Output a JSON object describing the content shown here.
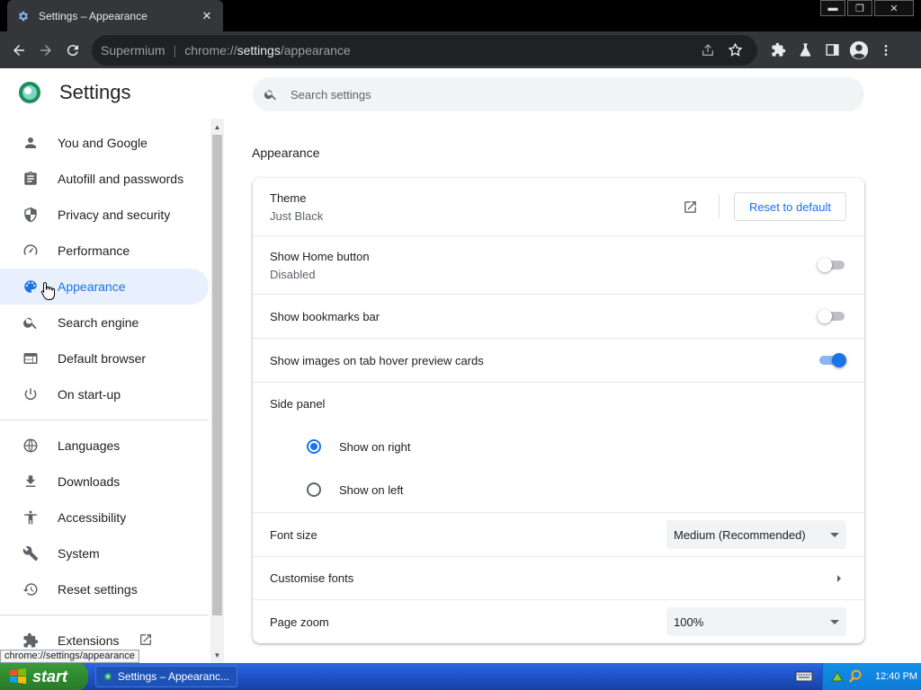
{
  "tab": {
    "title": "Settings – Appearance",
    "close": "✕"
  },
  "window": {
    "minimize": "▬",
    "restore": "❐",
    "close": "✕"
  },
  "omnibox": {
    "origin": "Supermium",
    "separator": "|",
    "scheme": "chrome://",
    "host": "settings",
    "path": "/appearance"
  },
  "header": {
    "title": "Settings",
    "search_placeholder": "Search settings"
  },
  "sidebar": {
    "group1": [
      {
        "label": "You and Google",
        "icon": "person-icon"
      },
      {
        "label": "Autofill and passwords",
        "icon": "clipboard-icon"
      },
      {
        "label": "Privacy and security",
        "icon": "shield-icon"
      },
      {
        "label": "Performance",
        "icon": "speedometer-icon"
      },
      {
        "label": "Appearance",
        "icon": "palette-icon",
        "active": true
      },
      {
        "label": "Search engine",
        "icon": "search-icon"
      },
      {
        "label": "Default browser",
        "icon": "browser-window-icon"
      },
      {
        "label": "On start-up",
        "icon": "power-icon"
      }
    ],
    "group2": [
      {
        "label": "Languages",
        "icon": "globe-icon"
      },
      {
        "label": "Downloads",
        "icon": "download-icon"
      },
      {
        "label": "Accessibility",
        "icon": "accessibility-icon"
      },
      {
        "label": "System",
        "icon": "wrench-icon"
      },
      {
        "label": "Reset settings",
        "icon": "history-icon"
      }
    ],
    "extensions": {
      "label": "Extensions",
      "icon": "puzzle-icon"
    }
  },
  "appearance": {
    "section_title": "Appearance",
    "theme": {
      "label": "Theme",
      "value": "Just Black",
      "reset_label": "Reset to default"
    },
    "home_button": {
      "label": "Show Home button",
      "value": "Disabled",
      "enabled": false
    },
    "bookmarks_bar": {
      "label": "Show bookmarks bar",
      "enabled": false
    },
    "hover_cards": {
      "label": "Show images on tab hover preview cards",
      "enabled": true
    },
    "side_panel": {
      "label": "Side panel",
      "options": [
        "Show on right",
        "Show on left"
      ],
      "selected": "Show on right"
    },
    "font_size": {
      "label": "Font size",
      "value": "Medium (Recommended)"
    },
    "customise_fonts": {
      "label": "Customise fonts"
    },
    "page_zoom": {
      "label": "Page zoom",
      "value": "100%"
    }
  },
  "status_url": "chrome://settings/appearance",
  "taskbar": {
    "start_label": "start",
    "task_title": "Settings – Appearanc...",
    "time": "12:40 PM"
  },
  "colors": {
    "accent": "#1a73e8",
    "active_bg": "#e8f0fe",
    "toolbar": "#35363a",
    "taskbar": "#245edb",
    "start": "#2e8b2e"
  }
}
